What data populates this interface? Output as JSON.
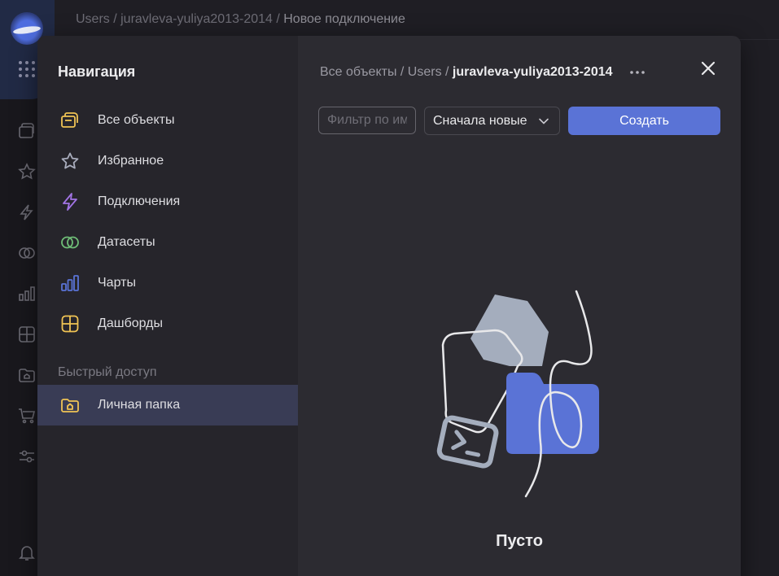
{
  "topbar": {
    "crumbs": [
      "Users",
      "juravleva-yuliya2013-2014"
    ],
    "separator": " / ",
    "current": "Новое подключение"
  },
  "nav": {
    "title": "Навигация",
    "items": [
      {
        "label": "Все объекты",
        "icon": "folders-icon",
        "color": "#f0c454"
      },
      {
        "label": "Избранное",
        "icon": "star-icon",
        "color": "#a9adbd"
      },
      {
        "label": "Подключения",
        "icon": "bolt-icon",
        "color": "#a274e6"
      },
      {
        "label": "Датасеты",
        "icon": "dataset-rings-icon",
        "color": "#6fbd77"
      },
      {
        "label": "Чарты",
        "icon": "bar-chart-icon",
        "color": "#5a73d6"
      },
      {
        "label": "Дашборды",
        "icon": "dashboard-grid-icon",
        "color": "#f0c454"
      }
    ],
    "quick_title": "Быстрый доступ",
    "quick_items": [
      {
        "label": "Личная папка",
        "icon": "home-folder-icon",
        "color": "#f0c454"
      }
    ]
  },
  "content": {
    "crumbs": [
      "Все объекты",
      "Users"
    ],
    "separator": " / ",
    "current": "juravleva-yuliya2013-2014",
    "filter_placeholder": "Фильтр по имени",
    "sort_value": "Сначала новые",
    "create_label": "Создать",
    "empty_text": "Пусто"
  },
  "colors": {
    "accent": "#5a73d6",
    "active_nav": "#393c55"
  }
}
